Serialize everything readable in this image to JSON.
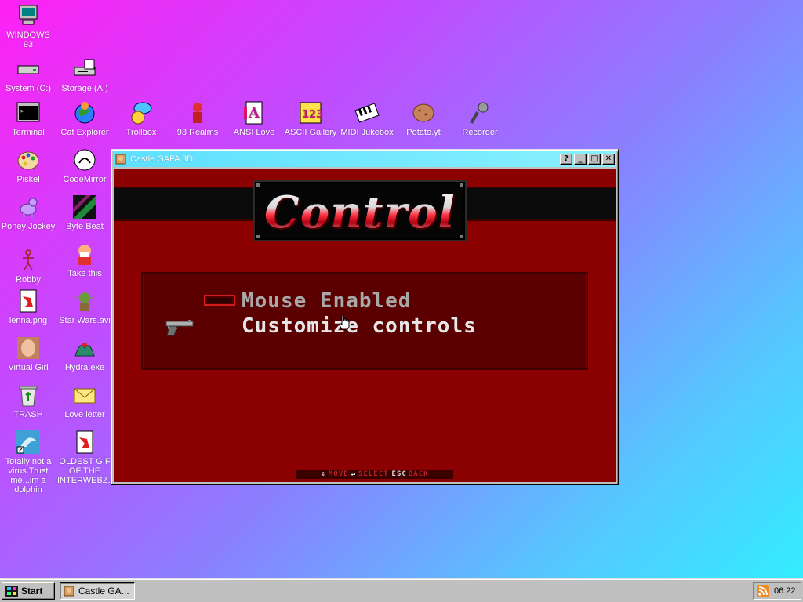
{
  "desktop": {
    "icons": [
      {
        "label": "WINDOWS 93"
      },
      {
        "label": "System (C:)"
      },
      {
        "label": "Storage (A:)"
      },
      {
        "label": "Terminal"
      },
      {
        "label": "Cat Explorer"
      },
      {
        "label": "Trollbox"
      },
      {
        "label": "93 Realms"
      },
      {
        "label": "ANSI Love"
      },
      {
        "label": "ASCII Gallery"
      },
      {
        "label": "MIDI Jukebox"
      },
      {
        "label": "Potato.yt"
      },
      {
        "label": "Recorder"
      },
      {
        "label": "Piskel"
      },
      {
        "label": "CodeMirror"
      },
      {
        "label": "Poney Jockey"
      },
      {
        "label": "Byte Beat"
      },
      {
        "label": "Robby"
      },
      {
        "label": "Take this"
      },
      {
        "label": "lenna.png"
      },
      {
        "label": "Star Wars.avi"
      },
      {
        "label": "Virtual Girl"
      },
      {
        "label": "Hydra.exe"
      },
      {
        "label": "TRASH"
      },
      {
        "label": "Love letter"
      },
      {
        "label": "Totally not a virus.Trust me...im a dolphin"
      },
      {
        "label": "OLDEST GIF OF THE INTERWEBZ.gif"
      }
    ]
  },
  "window": {
    "title": "Castle GAFA 3D",
    "buttons": {
      "help": "?",
      "minimize": "_",
      "maximize": "□",
      "close": "✕"
    },
    "game": {
      "logo": "Control",
      "menu": [
        {
          "label": "Mouse Enabled",
          "toggle_on": false
        },
        {
          "label": "Customize controls"
        }
      ],
      "footer": {
        "move": "MOVE",
        "select": "SELECT",
        "esc": "ESC",
        "back": "BACK"
      }
    }
  },
  "taskbar": {
    "start_label": "Start",
    "task_label": "Castle GA...",
    "clock": "06:22"
  },
  "colors": {
    "game_bg": "#8b0000",
    "titlebar": "#5ce0ff",
    "desktop_gradient_start": "#ff20f5",
    "desktop_gradient_end": "#30f0ff"
  }
}
